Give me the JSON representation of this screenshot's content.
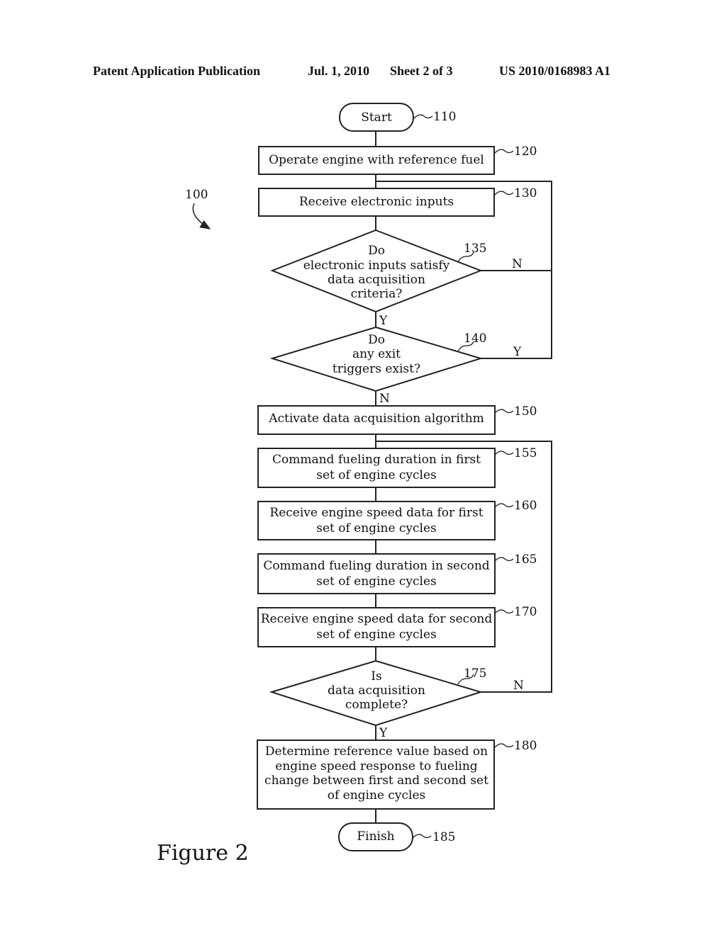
{
  "header": {
    "publication": "Patent Application Publication",
    "date": "Jul. 1, 2010",
    "sheet": "Sheet 2 of 3",
    "number": "US 2010/0168983 A1"
  },
  "diagram": {
    "label": "100",
    "figure_caption": "Figure 2",
    "nodes": {
      "start": {
        "ref": "110",
        "lines": [
          "Start"
        ]
      },
      "n120": {
        "ref": "120",
        "lines": [
          "Operate engine with reference fuel"
        ]
      },
      "n130": {
        "ref": "130",
        "lines": [
          "Receive electronic inputs"
        ]
      },
      "n135": {
        "ref": "135",
        "lines": [
          "Do",
          "electronic inputs satisfy",
          "data acquisition",
          "criteria?"
        ],
        "yes": "Y",
        "no": "N"
      },
      "n140": {
        "ref": "140",
        "lines": [
          "Do",
          "any exit",
          "triggers exist?"
        ],
        "yes": "Y",
        "no": "N"
      },
      "n150": {
        "ref": "150",
        "lines": [
          "Activate data acquisition algorithm"
        ]
      },
      "n155": {
        "ref": "155",
        "lines": [
          "Command fueling duration in first",
          "set of engine cycles"
        ]
      },
      "n160": {
        "ref": "160",
        "lines": [
          "Receive engine speed data for first",
          "set of engine cycles"
        ]
      },
      "n165": {
        "ref": "165",
        "lines": [
          "Command fueling duration in second",
          "set of engine cycles"
        ]
      },
      "n170": {
        "ref": "170",
        "lines": [
          "Receive engine speed data for second",
          "set of engine cycles"
        ]
      },
      "n175": {
        "ref": "175",
        "lines": [
          "Is",
          "data acquisition",
          "complete?"
        ],
        "yes": "Y",
        "no": "N"
      },
      "n180": {
        "ref": "180",
        "lines": [
          "Determine reference value based on",
          "engine speed response to fueling",
          "change between first and second set",
          "of engine cycles"
        ]
      },
      "finish": {
        "ref": "185",
        "lines": [
          "Finish"
        ]
      }
    }
  }
}
